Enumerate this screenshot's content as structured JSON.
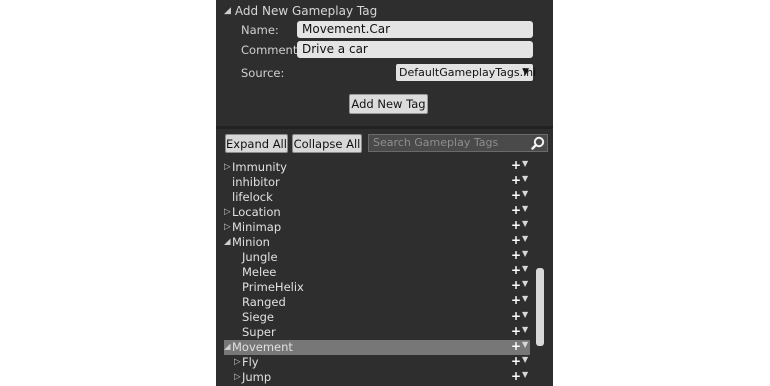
{
  "add_section": {
    "header": "Add New Gameplay Tag",
    "name_label": "Name:",
    "name_value": "Movement.Car",
    "comment_label": "Comment:",
    "comment_value": "Drive a car",
    "source_label": "Source:",
    "source_value": "DefaultGameplayTags.ini",
    "add_button": "Add New Tag"
  },
  "toolbar": {
    "expand_all": "Expand All",
    "collapse_all": "Collapse All",
    "search_placeholder": "Search Gameplay Tags"
  },
  "tags": [
    {
      "label": "Immunity",
      "arrow": "▷",
      "depth": 0,
      "selected": false
    },
    {
      "label": "inhibitor",
      "arrow": "",
      "depth": 0,
      "selected": false
    },
    {
      "label": "lifelock",
      "arrow": "",
      "depth": 0,
      "selected": false
    },
    {
      "label": "Location",
      "arrow": "▷",
      "depth": 0,
      "selected": false
    },
    {
      "label": "Minimap",
      "arrow": "▷",
      "depth": 0,
      "selected": false
    },
    {
      "label": "Minion",
      "arrow": "◢",
      "depth": 0,
      "selected": false
    },
    {
      "label": "Jungle",
      "arrow": "",
      "depth": 1,
      "selected": false
    },
    {
      "label": "Melee",
      "arrow": "",
      "depth": 1,
      "selected": false
    },
    {
      "label": "PrimeHelix",
      "arrow": "",
      "depth": 1,
      "selected": false
    },
    {
      "label": "Ranged",
      "arrow": "",
      "depth": 1,
      "selected": false
    },
    {
      "label": "Siege",
      "arrow": "",
      "depth": 1,
      "selected": false
    },
    {
      "label": "Super",
      "arrow": "",
      "depth": 1,
      "selected": false
    },
    {
      "label": "Movement",
      "arrow": "◢",
      "depth": 0,
      "selected": true
    },
    {
      "label": "Fly",
      "arrow": "▷",
      "depth": 1,
      "selected": false
    },
    {
      "label": "Jump",
      "arrow": "▷",
      "depth": 1,
      "selected": false
    }
  ],
  "row_actions": {
    "add": "+",
    "menu": "▼"
  },
  "colors": {
    "panel": "#2e2e2e",
    "selected_row": "#777777",
    "field": "#e4e4e4"
  }
}
